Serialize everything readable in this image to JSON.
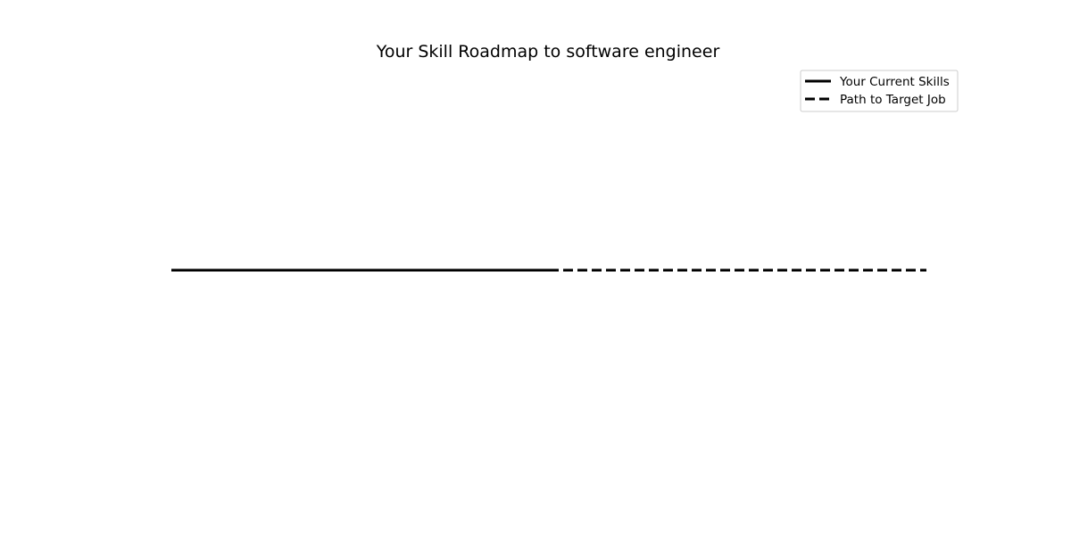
{
  "chart_data": {
    "type": "line",
    "title": "Your Skill Roadmap to software engineer",
    "xlabel": "",
    "ylabel": "",
    "axes_visible": false,
    "grid": false,
    "legend_position": "top-right",
    "series": [
      {
        "name": "Your Current Skills",
        "style": "solid",
        "color": "#000000",
        "x": [
          0,
          1
        ],
        "y": [
          0,
          0
        ]
      },
      {
        "name": "Path to Target Job",
        "style": "dashed",
        "color": "#000000",
        "x": [
          1,
          2
        ],
        "y": [
          0,
          0
        ]
      }
    ]
  }
}
